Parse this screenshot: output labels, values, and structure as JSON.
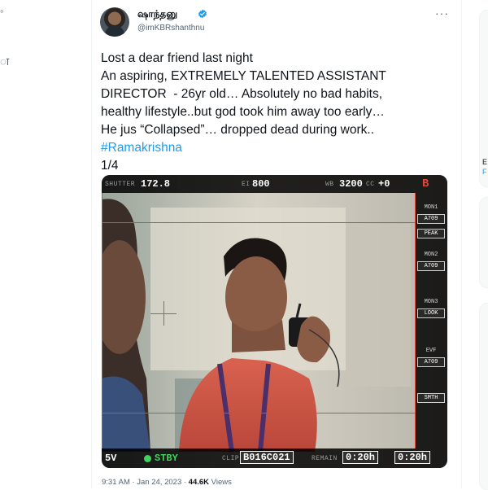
{
  "left_column": {
    "fragment": "ा"
  },
  "tweet": {
    "author": {
      "display_name": "ஷாந்தனு",
      "handle": "@imKBRshanthnu",
      "verified": true
    },
    "more_menu": "···",
    "text_lines": [
      "Lost a dear friend last night",
      "An aspiring, EXTREMELY TALENTED ASSISTANT",
      "DIRECTOR  - 26yr old… Absolutely no bad habits,",
      "healthy lifestyle..but god took him away too early…",
      "He jus “Collapsed”… dropped dead during work.."
    ],
    "hashtag": "#Ramakrishna",
    "counter": "1/4",
    "timestamp": "9:31 AM · Jan 24, 2023 · ",
    "views_count": "44.6K",
    "views_label": " Views"
  },
  "camera_hud": {
    "shutter_label": "SHUTTER",
    "shutter_value": "172.8",
    "ei_label": "EI",
    "ei_value": "800",
    "wb_label": "WB",
    "wb_value": "3200",
    "cc_label": "CC",
    "cc_value": "+0",
    "corner_letter": "B",
    "voltage": "5V",
    "status": "STBY",
    "clip_label": "CLIP",
    "clip_value": "B016C021",
    "remain_label": "REMAIN",
    "remain_value": "0:20h",
    "tc_value": "0:20h",
    "side_panel": {
      "mon1_label": "MON1",
      "mon1_lut": "A709",
      "mon1_mode": "PEAK",
      "mon2_label": "MON2",
      "mon2_lut": "A709",
      "mon3_label": "MON3",
      "mon3_mode": "LOOK",
      "evf_label": "EVF",
      "evf_lut": "A709",
      "extra": "SMTH"
    }
  },
  "right_column": {
    "card_char": "E",
    "card_link": "F"
  },
  "colors": {
    "link": "#1d9bf0",
    "text": "#0f1419",
    "muted": "#536471",
    "hud_red": "#e0463a",
    "hud_green": "#3fd35b"
  }
}
